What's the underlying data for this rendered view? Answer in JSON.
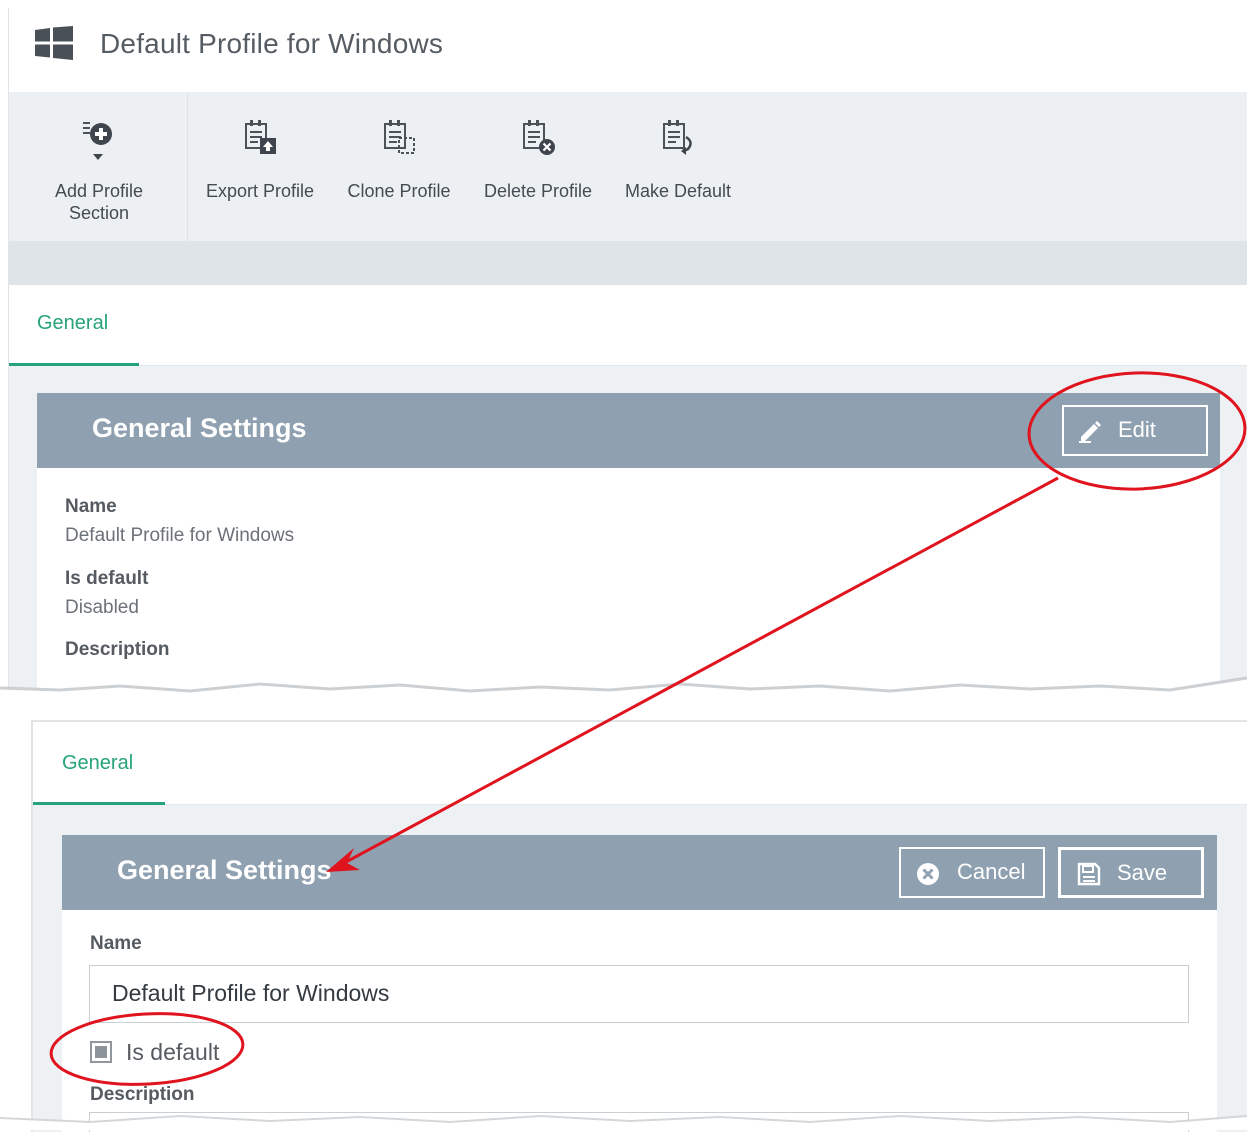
{
  "header": {
    "title": "Default Profile for Windows"
  },
  "toolbar": {
    "add_section_line1": "Add Profile",
    "add_section_line2": "Section",
    "export": "Export Profile",
    "clone": "Clone Profile",
    "delete": "Delete Profile",
    "make_default": "Make Default"
  },
  "view_panel": {
    "tab": "General",
    "title": "General Settings",
    "edit_label": "Edit",
    "fields": {
      "name_label": "Name",
      "name_value": "Default Profile for Windows",
      "is_default_label": "Is default",
      "is_default_value": "Disabled",
      "description_label": "Description"
    }
  },
  "edit_panel": {
    "tab": "General",
    "title": "General Settings",
    "cancel_label": "Cancel",
    "save_label": "Save",
    "name_label": "Name",
    "name_value": "Default Profile for Windows",
    "is_default_label": "Is default",
    "is_default_checked": false,
    "description_label": "Description"
  },
  "colors": {
    "accent": "#26a37a",
    "panel_header": "#8fa0b0",
    "toolbar_bg": "#edf0f3",
    "annotation": "#e0141e"
  }
}
